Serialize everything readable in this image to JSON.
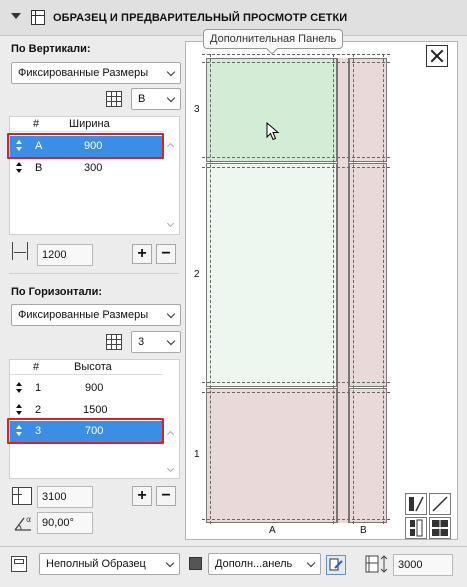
{
  "header": {
    "title": "ОБРАЗЕЦ И ПРЕДВАРИТЕЛЬНЫЙ ПРОСМОТР СЕТКИ"
  },
  "vertical": {
    "label": "По Вертикали:",
    "mode": "Фиксированные Размеры",
    "count": "B",
    "table": {
      "col_num": "#",
      "col_value": "Ширина",
      "rows": [
        {
          "id": "A",
          "value": "900",
          "selected": true
        },
        {
          "id": "B",
          "value": "300",
          "selected": false
        }
      ]
    },
    "total": "1200"
  },
  "horizontal": {
    "label": "По Горизонтали:",
    "mode": "Фиксированные Размеры",
    "count": "3",
    "table": {
      "col_num": "#",
      "col_value": "Высота",
      "rows": [
        {
          "id": "1",
          "value": "900",
          "selected": false
        },
        {
          "id": "2",
          "value": "1500",
          "selected": false
        },
        {
          "id": "3",
          "value": "700",
          "selected": true
        }
      ]
    },
    "total": "3100",
    "angle": "90,00°"
  },
  "buttons": {
    "plus": "+",
    "minus": "−"
  },
  "preview": {
    "tooltip": "Дополнительная Панель",
    "row_labels": [
      "3",
      "2",
      "1"
    ],
    "col_labels": [
      "A",
      "B"
    ]
  },
  "footer": {
    "sample": "Неполный Образец",
    "panel": "Дополн...анель",
    "height": "3000"
  },
  "colors": {
    "selection": "#3a8ee6",
    "highlight_border": "#e02020",
    "panel_green": "#d3ecd6",
    "panel_green_light": "#eef7ef",
    "panel_pink": "#ead9d9"
  },
  "icons": [
    "collapse-arrow-icon",
    "grid-settings-icon",
    "grid-icon",
    "sort-icon",
    "width-icon",
    "height-icon",
    "angle-icon",
    "close-icon",
    "cursor-icon",
    "panel-icon",
    "edit-icon"
  ]
}
